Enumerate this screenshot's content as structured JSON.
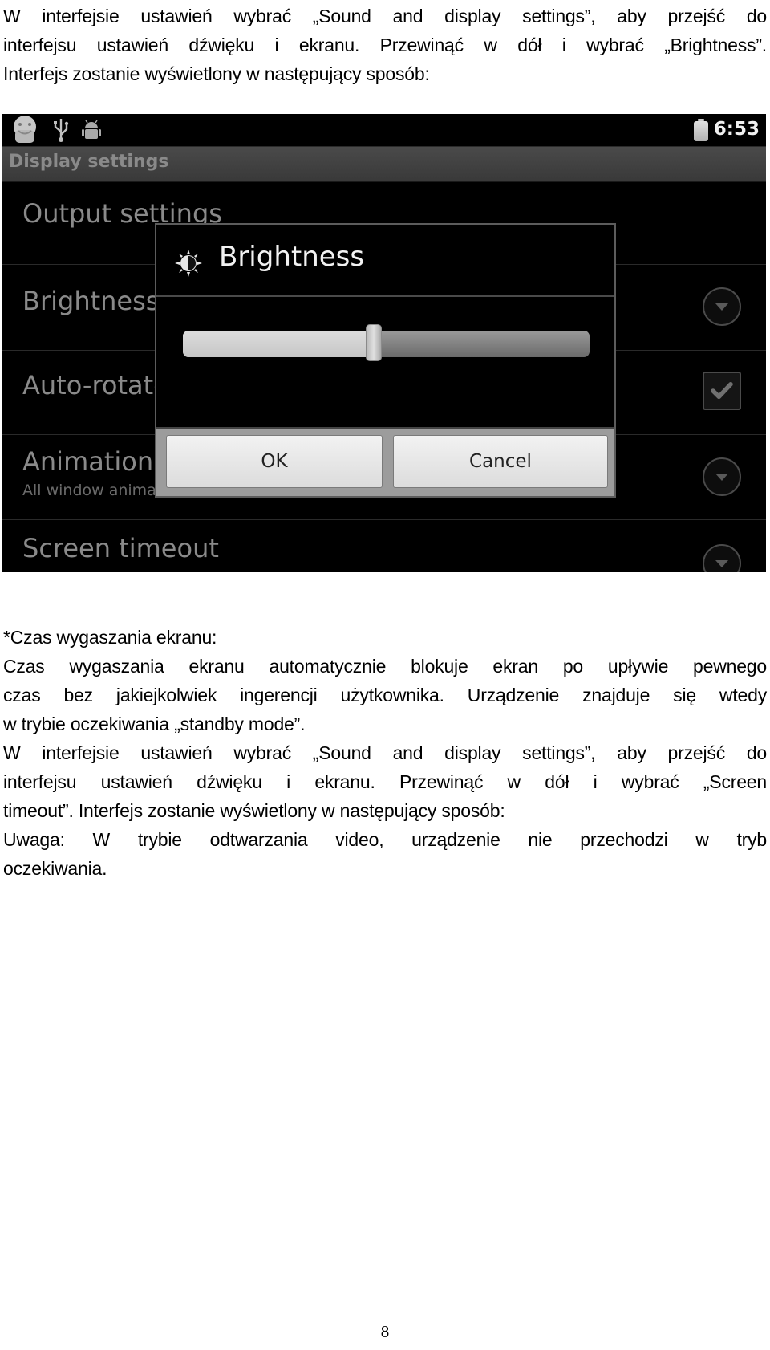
{
  "intro_paragraph": {
    "lines": [
      "W interfejsie ustawień wybrać „Sound and display settings”, aby przejść do",
      "interfejsu ustawień dźwięku i ekranu. Przewinąć w dół i wybrać „Brightness”.",
      "Interfejs zostanie wyświetlony w następujący sposób:"
    ]
  },
  "screenshot": {
    "status_bar": {
      "icons": [
        "android-notification-icon",
        "usb-icon",
        "usb-debugging-icon",
        "battery-icon"
      ],
      "time": "6:53"
    },
    "title_bar": "Display settings",
    "settings": [
      {
        "title": "Output settings",
        "widget": "none"
      },
      {
        "title": "Brightness",
        "widget": "dropdown"
      },
      {
        "title": "Auto-rotate screen",
        "widget": "checkbox",
        "checked": true
      },
      {
        "title": "Animation",
        "summary": "All window animations are shown",
        "widget": "dropdown"
      },
      {
        "title": "Screen timeout",
        "widget": "dropdown"
      }
    ],
    "dialog": {
      "icon": "brightness-icon",
      "title": "Brightness",
      "slider_value_fraction": 0.47,
      "ok_label": "OK",
      "cancel_label": "Cancel"
    }
  },
  "section": {
    "lines": [
      "*Czas wygaszania ekranu:",
      "Czas wygaszania ekranu automatycznie blokuje ekran po upływie pewnego",
      "czas bez jakiejkolwiek ingerencji użytkownika. Urządzenie znajduje się wtedy",
      "w trybie oczekiwania „standby mode”.",
      "W interfejsie ustawień wybrać „Sound and display settings”, aby przejść do",
      "interfejsu ustawień dźwięku i ekranu. Przewinąć w dół i wybrać „Screen",
      "timeout”. Interfejs zostanie wyświetlony w następujący sposób:",
      "Uwaga: W trybie odtwarzania video, urządzenie nie przechodzi w tryb",
      "oczekiwania."
    ]
  },
  "page_number": "8"
}
